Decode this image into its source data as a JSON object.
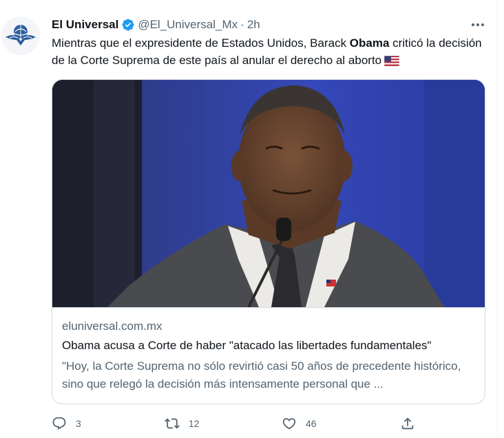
{
  "tweet": {
    "author_name": "El Universal",
    "handle": "@El_Universal_Mx",
    "separator": "·",
    "time": "2h",
    "text_before": "Mientras que el expresidente de Estados Unidos, Barack ",
    "text_bold": "Obama",
    "text_after": " criticó la decisión de la Corte Suprema de este país al anular el derecho al aborto"
  },
  "card": {
    "domain": "eluniversal.com.mx",
    "title": "Obama acusa a Corte de haber \"atacado las libertades fundamentales\"",
    "description": "\"Hoy, la Corte Suprema no sólo revirtió casi 50 años de precedente histórico, sino que relegó la decisión más intensamente personal que ..."
  },
  "actions": {
    "reply_count": "3",
    "retweet_count": "12",
    "like_count": "46"
  },
  "colors": {
    "text": "#0f1419",
    "secondary": "#536471",
    "verified": "#1d9bf0",
    "border": "#cfd9de"
  }
}
